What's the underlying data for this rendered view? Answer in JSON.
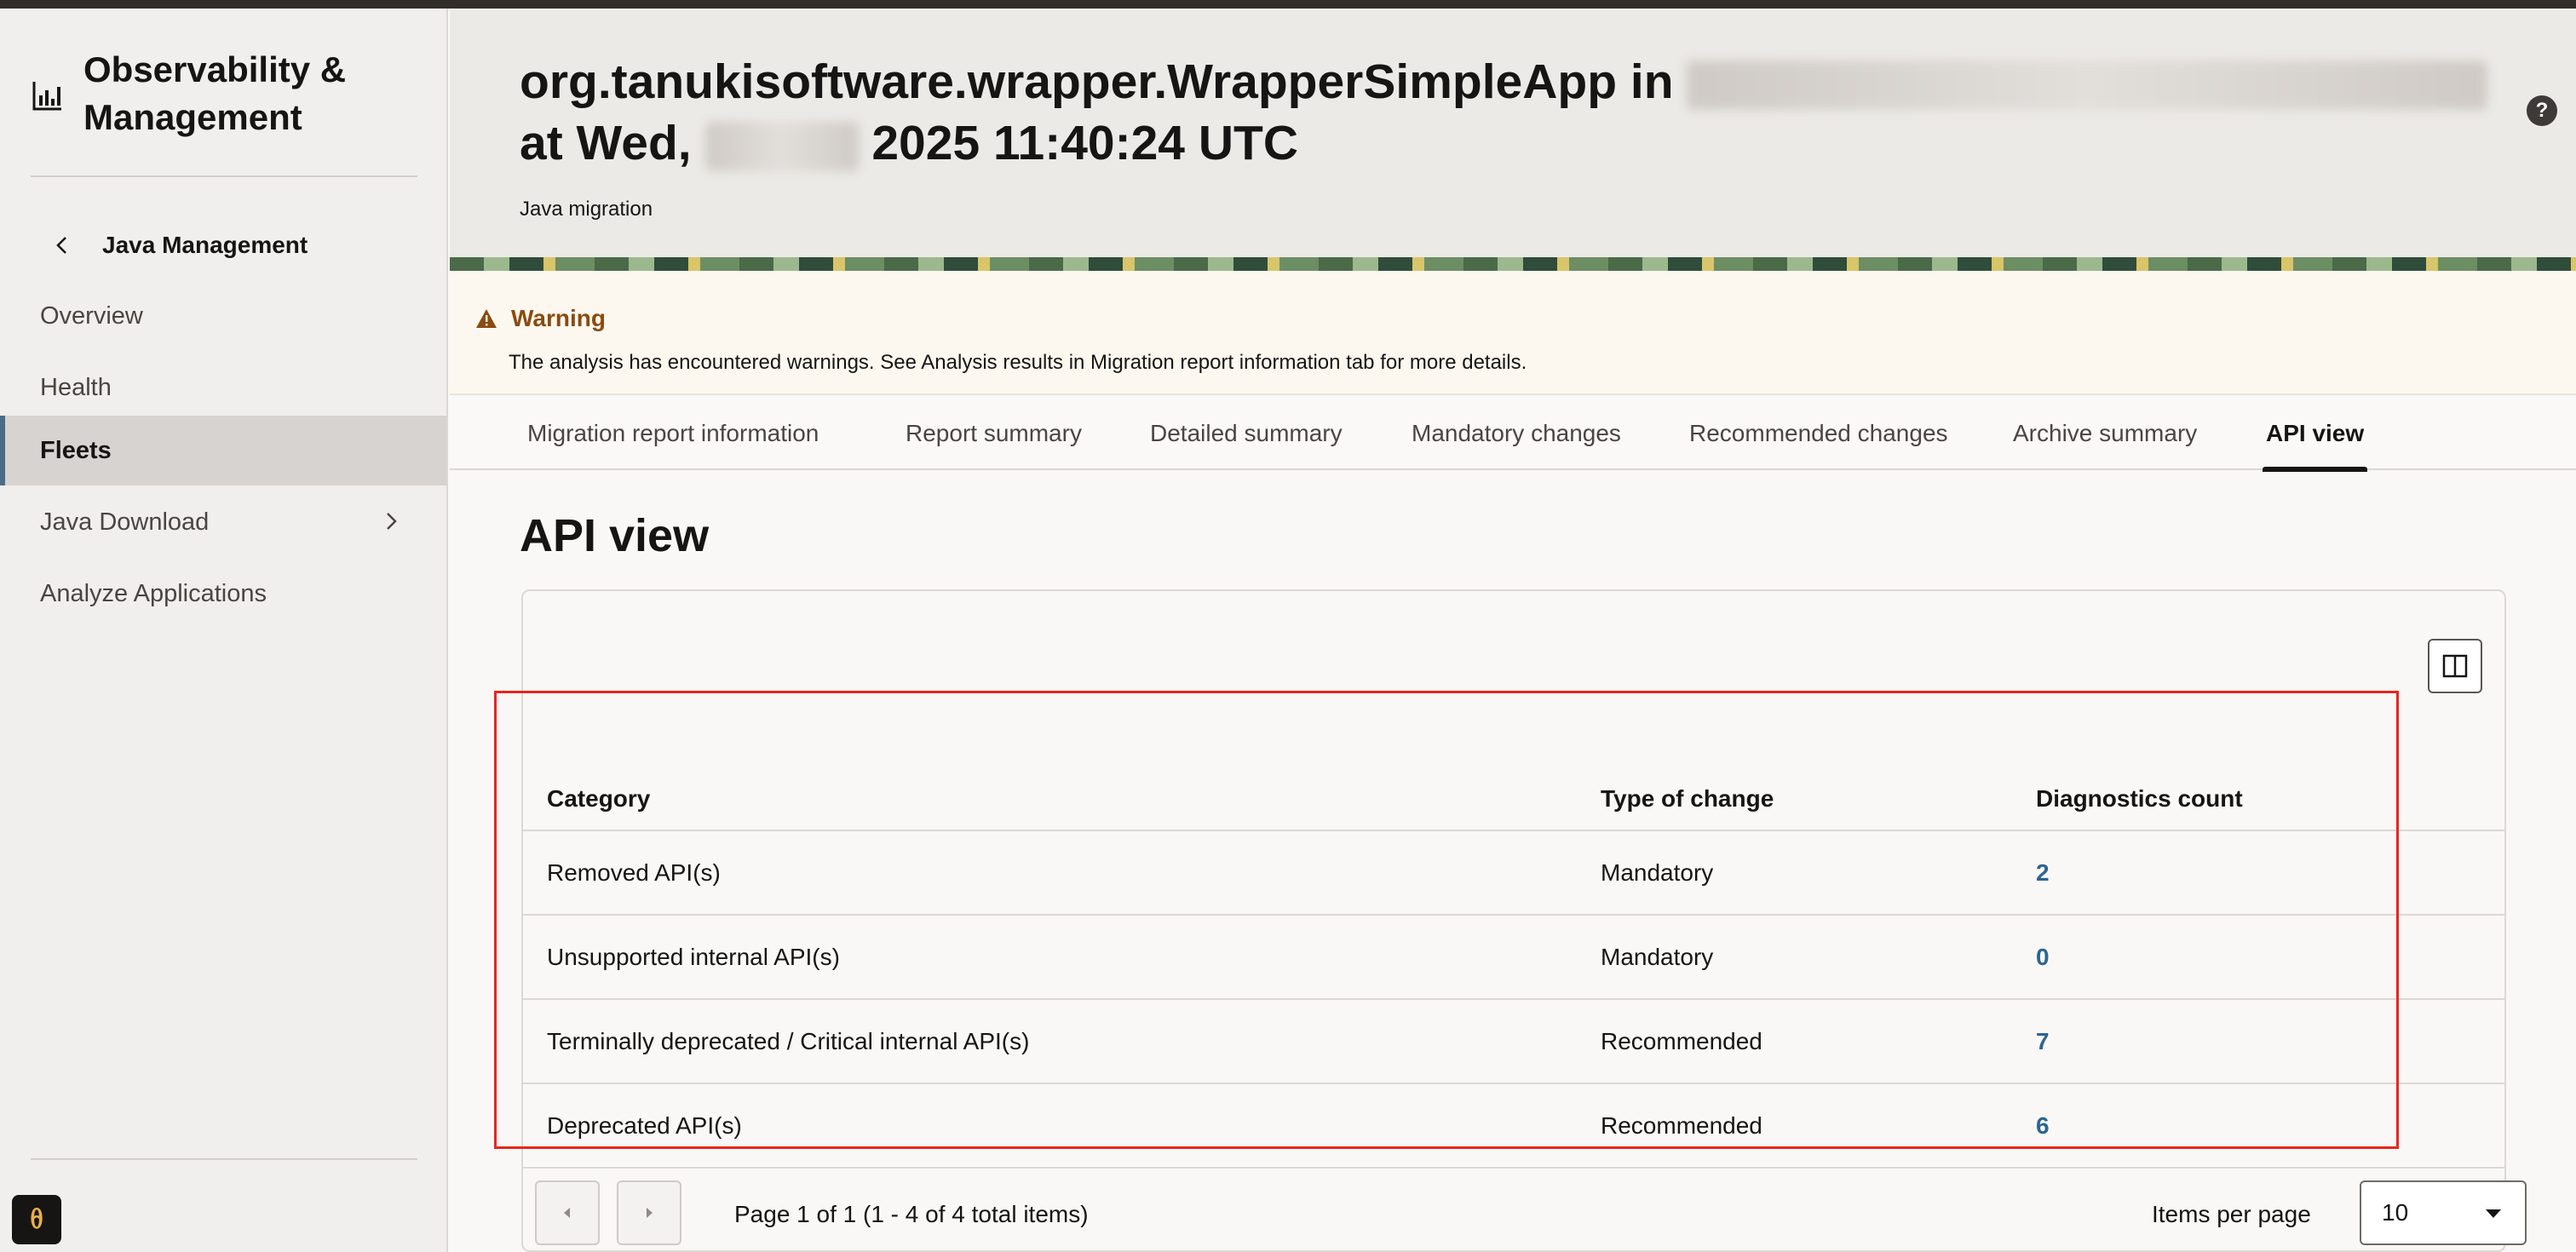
{
  "sidebar": {
    "brand_title": "Observability & Management",
    "back_label": "Java Management",
    "items": [
      {
        "label": "Overview"
      },
      {
        "label": "Health"
      },
      {
        "label": "Fleets",
        "active": true
      },
      {
        "label": "Java Download",
        "has_submenu": true
      },
      {
        "label": "Analyze Applications"
      }
    ]
  },
  "header": {
    "title_prefix": "org.tanukisoftware.wrapper.WrapperSimpleApp in",
    "title_at": "at Wed,",
    "title_suffix": "2025 11:40:24 UTC",
    "subtitle": "Java migration",
    "help_icon": "?"
  },
  "warning": {
    "title": "Warning",
    "text": "The analysis has encountered warnings. See Analysis results in Migration report information tab for more details."
  },
  "tabs": [
    {
      "label": "Migration report information"
    },
    {
      "label": "Report summary"
    },
    {
      "label": "Detailed summary"
    },
    {
      "label": "Mandatory changes"
    },
    {
      "label": "Recommended changes"
    },
    {
      "label": "Archive summary"
    },
    {
      "label": "API view",
      "active": true
    }
  ],
  "section_title": "API view",
  "table": {
    "columns": [
      "Category",
      "Type of change",
      "Diagnostics count"
    ],
    "rows": [
      {
        "category": "Removed API(s)",
        "type": "Mandatory",
        "count": "2"
      },
      {
        "category": "Unsupported internal API(s)",
        "type": "Mandatory",
        "count": "0"
      },
      {
        "category": "Terminally deprecated / Critical internal API(s)",
        "type": "Recommended",
        "count": "7"
      },
      {
        "category": "Deprecated API(s)",
        "type": "Recommended",
        "count": "6"
      }
    ]
  },
  "pager": {
    "text": "Page 1 of 1 (1 - 4 of 4 total items)",
    "items_per_page_label": "Items per page",
    "items_per_page_value": "10"
  },
  "colors": {
    "accent_link": "#2b6593",
    "warning_title": "#8a4b11",
    "highlight_box": "#e8261b"
  }
}
